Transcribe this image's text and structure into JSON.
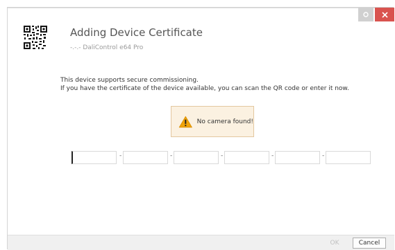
{
  "dialog": {
    "title": "Adding Device Certificate",
    "subtitle": "-.-.- DaliControl e64 Pro",
    "description_line1": "This device supports secure commissioning.",
    "description_line2": "If you have the certificate of the device available, you can scan the QR code or enter it now."
  },
  "warning": {
    "text": "No camera found!",
    "icon": "warning-triangle-icon",
    "color": "#f0a30a"
  },
  "certificate_fields": {
    "values": [
      "",
      "",
      "",
      "",
      "",
      ""
    ],
    "separator": "-"
  },
  "footer": {
    "ok_label": "OK",
    "cancel_label": "Cancel"
  },
  "titlebar": {
    "close_icon": "close-icon",
    "settings_icon": "gear-icon",
    "close_color": "#d9534f"
  }
}
